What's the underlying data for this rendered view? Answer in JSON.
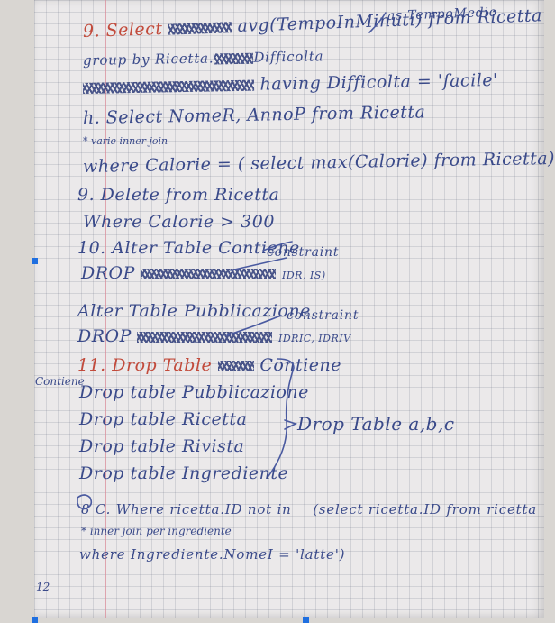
{
  "notebook": {
    "lines": [
      {
        "id": "q9_main",
        "text": "9. Select",
        "cont": "avg(TempoInMinuti)",
        "tail": "from Ricetta"
      },
      {
        "id": "q9_alias",
        "text": "as TempoMedio"
      },
      {
        "id": "q9_group",
        "text": "group by Ricetta.",
        "tail": "Difficolta"
      },
      {
        "id": "q9_having",
        "text": "having Difficolta = 'facile'"
      },
      {
        "id": "h_select",
        "text": "h. Select NomeR, AnnoP from Ricetta"
      },
      {
        "id": "h_join",
        "text": "* varie inner join"
      },
      {
        "id": "h_where",
        "text": "where Calorie = ( select max(Calorie) from Ricetta)"
      },
      {
        "id": "g_delete",
        "text": "9. Delete from Ricetta"
      },
      {
        "id": "g_where",
        "text": "Where Calorie > 300"
      },
      {
        "id": "alter1",
        "text": "10. Alter Table Contiene"
      },
      {
        "id": "constraint1",
        "text": "constraint"
      },
      {
        "id": "drop1",
        "text": "DROP"
      },
      {
        "id": "idr1",
        "text": "IDR, IS)"
      },
      {
        "id": "alter2",
        "text": "Alter Table Pubblicazione"
      },
      {
        "id": "constraint2",
        "text": "constraint"
      },
      {
        "id": "drop2",
        "text": "DROP"
      },
      {
        "id": "idr2",
        "text": "IDRIC, IDRIV"
      },
      {
        "id": "drop_contiene",
        "text": "11. Drop Table",
        "tail": "Contiene"
      },
      {
        "id": "margin_note",
        "text": "Contiene"
      },
      {
        "id": "drop_pub",
        "text": "Drop table Pubblicazione"
      },
      {
        "id": "drop_ricetta",
        "text": "Drop table Ricetta"
      },
      {
        "id": "drop_rivista",
        "text": "Drop table Rivista"
      },
      {
        "id": "drop_ingr",
        "text": "Drop table Ingrediente"
      },
      {
        "id": "drop_abc",
        "text": "Drop Table a,b,c"
      },
      {
        "id": "c_where",
        "text": "8 C. Where ricetta.ID not in",
        "tail": "(select ricetta.ID from ricetta"
      },
      {
        "id": "c_join",
        "text": "* inner join per ingrediente"
      },
      {
        "id": "c_where2",
        "text": "where Ingrediente.NomeI = 'latte')"
      },
      {
        "id": "page_mark",
        "text": "12"
      }
    ]
  },
  "colors": {
    "ink": "#3a4a8a",
    "paper": "#ebe9ea",
    "grid": "#8c91a0",
    "selection_handle": "#1f6fe0",
    "red_ink": "#c24b3c"
  }
}
